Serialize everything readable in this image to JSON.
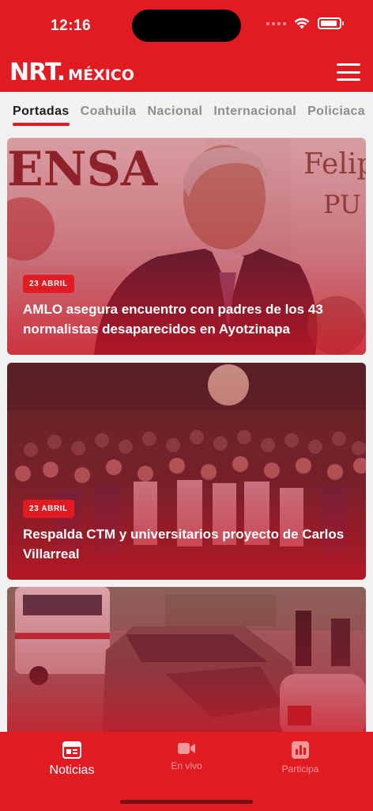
{
  "status_bar": {
    "time": "12:16"
  },
  "header": {
    "brand": "NRT.",
    "brand_sub": "MÉXICO"
  },
  "tabs": [
    {
      "label": "Portadas",
      "active": true
    },
    {
      "label": "Coahuila",
      "active": false
    },
    {
      "label": "Nacional",
      "active": false
    },
    {
      "label": "Internacional",
      "active": false
    },
    {
      "label": "Policiaca",
      "active": false
    }
  ],
  "articles": [
    {
      "date": "23 ABRIL",
      "title": "AMLO asegura encuentro con padres de los 43 normalistas desaparecidos en Ayotzinapa"
    },
    {
      "date": "23 ABRIL",
      "title": "Respalda CTM y universitarios proyecto de Carlos Villarreal"
    },
    {
      "date": "",
      "title": ""
    }
  ],
  "bottom_nav": [
    {
      "label": "Noticias",
      "icon": "newspaper-icon",
      "active": true
    },
    {
      "label": "En vivo",
      "icon": "video-camera-icon",
      "active": false
    },
    {
      "label": "Participa",
      "icon": "bar-chart-icon",
      "active": false
    }
  ],
  "colors": {
    "brand_red": "#e11b22",
    "background": "#f2f2f2",
    "active_tab_text": "#1c1c1c",
    "inactive_tab_text": "#8d8d8d"
  }
}
